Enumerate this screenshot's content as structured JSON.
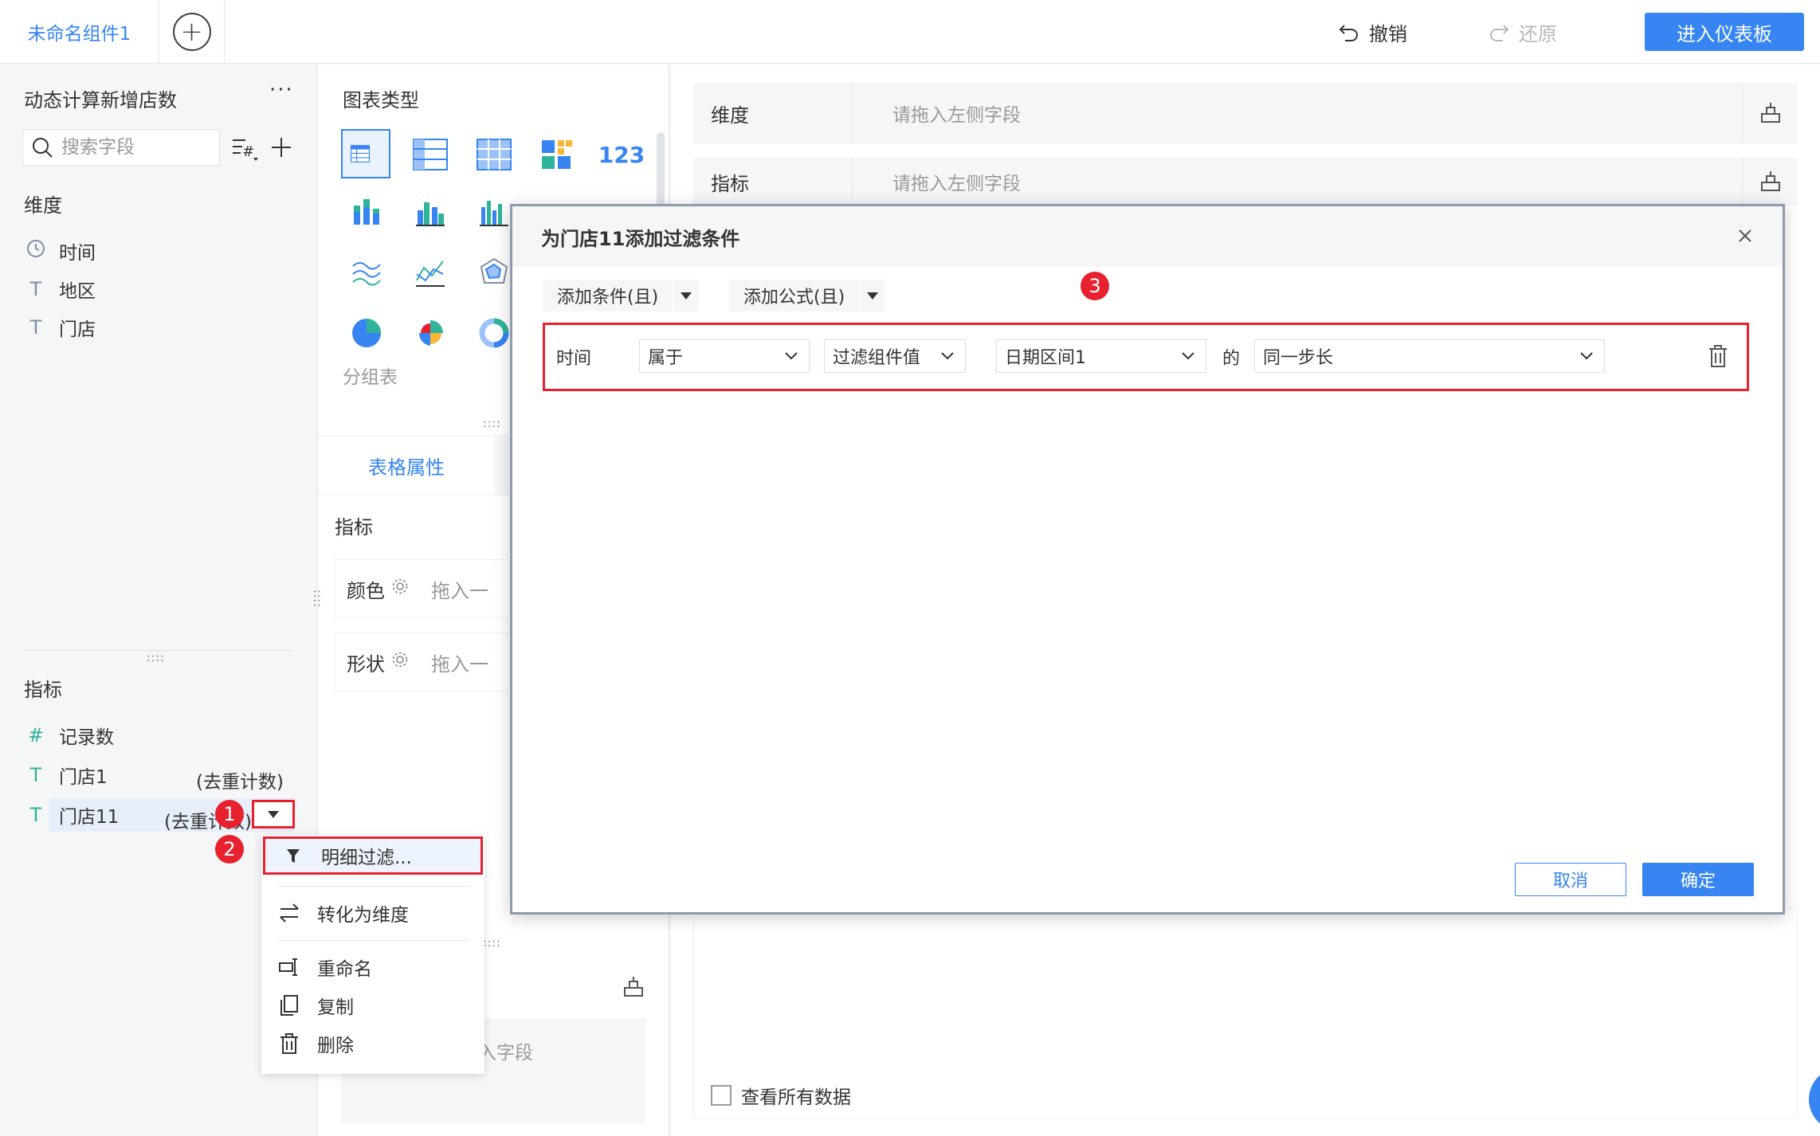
{
  "topbar": {
    "active_tab": "未命名组件1",
    "undo": "撤销",
    "redo": "还原",
    "enter_dashboard": "进入仪表板"
  },
  "left_panel": {
    "dataset_title": "动态计算新增店数",
    "more": "···",
    "search_placeholder": "搜索字段",
    "dimension_label": "维度",
    "dimensions": [
      {
        "icon": "clock-icon",
        "name": "时间"
      },
      {
        "icon": "text-icon",
        "name": "地区"
      },
      {
        "icon": "text-icon",
        "name": "门店"
      }
    ],
    "metric_label": "指标",
    "metrics": [
      {
        "icon": "number-icon",
        "name": "记录数",
        "suffix": ""
      },
      {
        "icon": "text-metric-icon",
        "name": "门店1",
        "suffix": "(去重计数)"
      },
      {
        "icon": "text-metric-icon",
        "name": "门店11",
        "suffix": "(去重计数)"
      }
    ],
    "splitter": "::::"
  },
  "annotations": {
    "badge1": "1",
    "badge2": "2",
    "badge3": "3"
  },
  "context_menu": {
    "items": [
      "明细过滤...",
      "转化为维度",
      "重命名",
      "复制",
      "删除"
    ]
  },
  "middle_panel": {
    "chart_type_title": "图表类型",
    "selected_chart_label": "分组表",
    "number_icon_text": "123",
    "table_props_tab": "表格属性",
    "metric_label": "指标",
    "color_label": "颜色",
    "shape_label": "形状",
    "drag_hint": "拖入一",
    "lower_hint": "入字段"
  },
  "right_panel": {
    "dimension_label": "维度",
    "metric_label": "指标",
    "drop_placeholder": "请拖入左侧字段",
    "view_all": "查看所有数据"
  },
  "dialog": {
    "title": "为门店11添加过滤条件",
    "add_condition": "添加条件(且)",
    "add_formula": "添加公式(且)",
    "condition": {
      "field": "时间",
      "operator": "属于",
      "value_type": "过滤组件值",
      "component": "日期区间1",
      "of": "的",
      "mode": "同一步长"
    },
    "cancel": "取消",
    "ok": "确定"
  },
  "colors": {
    "accent": "#3685f2",
    "highlight_red": "#e8212e"
  }
}
